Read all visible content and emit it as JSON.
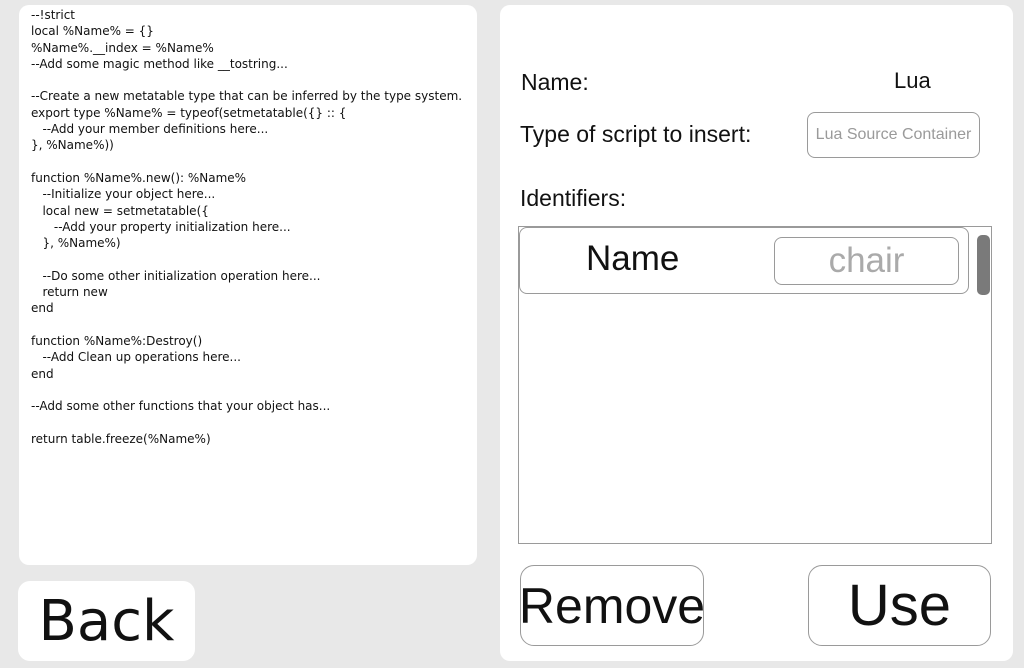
{
  "code": {
    "lines": [
      "--!strict",
      "local %Name% = {}",
      "%Name%.__index = %Name%",
      "--Add some magic method like __tostring...",
      "",
      "--Create a new metatable type that can be inferred by the type system.",
      "export type %Name% = typeof(setmetatable({} :: {",
      "   --Add your member definitions here...",
      "}, %Name%))",
      "",
      "function %Name%.new(): %Name%",
      "   --Initialize your object here...",
      "   local new = setmetatable({",
      "      --Add your property initialization here...",
      "   }, %Name%)",
      "",
      "   --Do some other initialization operation here...",
      "   return new",
      "end",
      "",
      "function %Name%:Destroy()",
      "   --Add Clean up operations here...",
      "end",
      "",
      "--Add some other functions that your object has...",
      "",
      "return table.freeze(%Name%)"
    ]
  },
  "back_button": {
    "label": "Back"
  },
  "form": {
    "name_label": "Name:",
    "name_value": "Lua",
    "type_label": "Type of script to insert:",
    "type_placeholder": "Lua Source Container",
    "identifiers_label": "Identifiers:",
    "identifiers": [
      {
        "label": "Name",
        "value": "chair"
      }
    ]
  },
  "actions": {
    "remove_label": "Remove",
    "use_label": "Use"
  }
}
